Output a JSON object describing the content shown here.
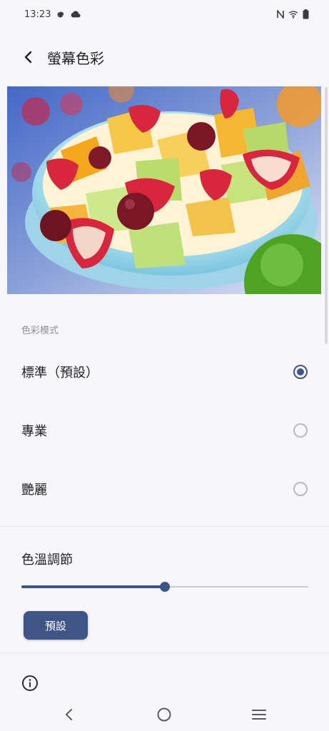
{
  "status_bar": {
    "time": "13:23",
    "left_icons": [
      "gear-icon",
      "cloud-icon"
    ],
    "right_icons": [
      "nfc-icon",
      "wifi-icon",
      "battery-icon"
    ]
  },
  "toolbar": {
    "title": "螢幕色彩",
    "back_icon": "back-arrow-icon"
  },
  "preview_image": {
    "subject": "fruit-salad-bowl"
  },
  "color_mode": {
    "header": "色彩模式",
    "options": [
      {
        "label": "標準（預設）",
        "selected": true
      },
      {
        "label": "專業",
        "selected": false
      },
      {
        "label": "艷麗",
        "selected": false
      }
    ]
  },
  "color_temperature": {
    "title": "色溫調節",
    "value_fraction": 0.5,
    "default_button": "預設"
  },
  "footer": {
    "info_icon": "info-icon"
  },
  "nav_bar": {
    "buttons": [
      "back-icon",
      "home-icon",
      "recents-icon"
    ]
  },
  "colors": {
    "accent": "#3f5588",
    "background": "#f7f7fb",
    "text_primary": "#1f1f24",
    "text_secondary": "#8d8f99"
  }
}
